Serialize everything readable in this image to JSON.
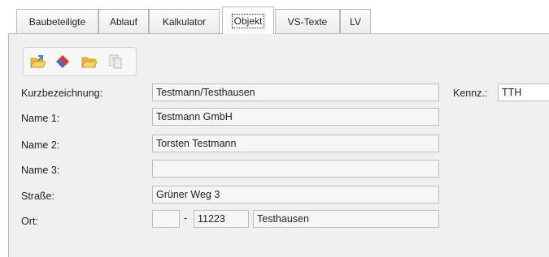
{
  "tabs": [
    {
      "label": "Baubeteiligte",
      "active": false
    },
    {
      "label": "Ablauf",
      "active": false
    },
    {
      "label": "Kalkulator",
      "active": false
    },
    {
      "label": "Objekt",
      "active": true
    },
    {
      "label": "VS-Texte",
      "active": false
    },
    {
      "label": "LV",
      "active": false
    }
  ],
  "toolbar": {
    "icons": [
      "open-folder-export-icon",
      "eraser-icon",
      "folder-icon",
      "copy-document-icon"
    ],
    "colors": {
      "folder": "#f5b52a",
      "eraser_red": "#d63a3a",
      "eraser_blue": "#3a6fd6",
      "arrow": "#2d8ad6",
      "disabled": "#b8b8b8"
    }
  },
  "form": {
    "kurzbezeichnung": {
      "label": "Kurzbezeichnung:",
      "value": "Testmann/Testhausen"
    },
    "kennz": {
      "label": "Kennz.:",
      "value": "TTH"
    },
    "name1": {
      "label": "Name 1:",
      "value": "Testmann GmbH"
    },
    "name2": {
      "label": "Name 2:",
      "value": "Torsten Testmann"
    },
    "name3": {
      "label": "Name 3:",
      "value": ""
    },
    "strasse": {
      "label": "Straße:",
      "value": "Grüner Weg 3"
    },
    "ort": {
      "label": "Ort:",
      "country": "",
      "separator": "-",
      "plz": "11223",
      "city": "Testhausen"
    }
  }
}
